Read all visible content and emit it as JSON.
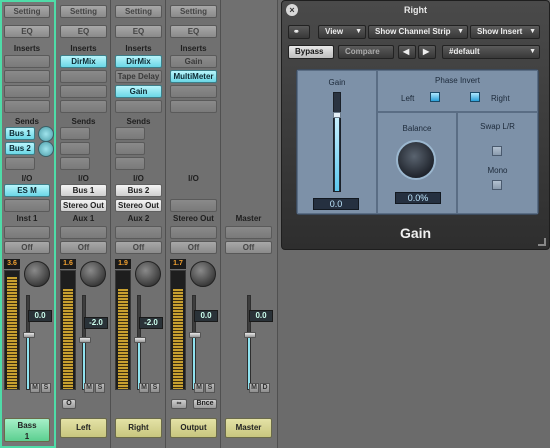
{
  "mixer": {
    "row_labels": {
      "inserts": "Inserts",
      "sends": "Sends",
      "io": "I/O"
    },
    "setting_label": "Setting",
    "eq_label": "EQ",
    "off_label": "Off",
    "strips": [
      {
        "name": "Inst 1",
        "inserts": [],
        "sends": [
          "Bus 1",
          "Bus 2"
        ],
        "input": "",
        "output": "ES M",
        "peak": "3.6",
        "volume": "0.0",
        "fader_level": 0.55,
        "meter_level": 0.95,
        "track_line1": "Bass",
        "track_line2": "1",
        "ms": [
          "M",
          "S"
        ]
      },
      {
        "name": "Aux 1",
        "inserts": [
          "DirMix"
        ],
        "sends": [],
        "input": "Bus 1",
        "output": "Stereo Out",
        "peak": "1.6",
        "volume": "-2.0",
        "fader_level": 0.5,
        "meter_level": 0.85,
        "track_name": "Left",
        "ms": [
          "M",
          "S"
        ],
        "bottom": "O"
      },
      {
        "name": "Aux 2",
        "inserts": [
          "DirMix",
          "Tape Delay",
          "Gain"
        ],
        "sends": [],
        "input": "Bus 2",
        "output": "Stereo Out",
        "peak": "1.9",
        "volume": "-2.0",
        "fader_level": 0.5,
        "meter_level": 0.85,
        "track_name": "Right",
        "ms": [
          "M",
          "S"
        ]
      },
      {
        "name": "Stereo Out",
        "inserts": [
          "Gain",
          "MultiMeter"
        ],
        "sends": [],
        "input": "",
        "output": "",
        "peak": "1.7",
        "volume": "0.0",
        "fader_level": 0.55,
        "meter_level": 0.85,
        "track_name": "Output",
        "ms": [
          "M",
          "S"
        ],
        "bottom_link": "∞",
        "bottom": "Bnce"
      },
      {
        "name": "Master",
        "inserts": [],
        "sends": [],
        "input": "",
        "output": "",
        "peak": "",
        "volume": "0.0",
        "fader_level": 0.55,
        "meter_level": 0,
        "track_name": "Master",
        "ms": [
          "M",
          "D"
        ]
      }
    ]
  },
  "plugin": {
    "title": "Right",
    "close_icon": "×",
    "link_icon": "⚭",
    "view_label": "View",
    "channel_strip_label": "Show Channel Strip",
    "insert_label": "Show Insert",
    "bypass_label": "Bypass",
    "compare_label": "Compare",
    "prev_label": "◀",
    "next_label": "▶",
    "preset": "#default",
    "gain_label": "Gain",
    "gain_value": "0.0",
    "gain_level": 0.75,
    "phase_invert_label": "Phase Invert",
    "left_label": "Left",
    "right_label": "Right",
    "balance_label": "Balance",
    "balance_value": "0.0%",
    "swap_label": "Swap L/R",
    "mono_label": "Mono",
    "plugin_name": "Gain"
  }
}
